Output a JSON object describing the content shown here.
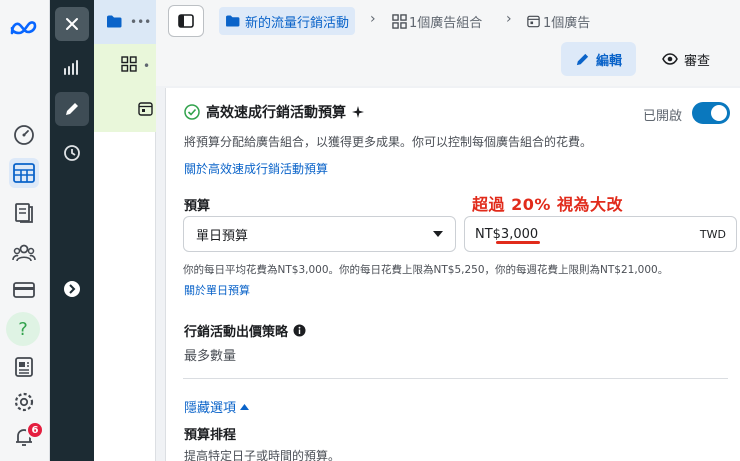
{
  "rail": {
    "icons": [
      "meta-logo-icon",
      "dashboard-gauge-icon",
      "ads-manager-table-icon",
      "catalog-book-icon",
      "audience-people-icon",
      "billing-card-icon",
      "help-icon",
      "news-icon",
      "settings-gear-icon",
      "notifications-bell-icon"
    ],
    "notifications_count": "6"
  },
  "tool_rail": {
    "icons": [
      "close-icon",
      "performance-chart-icon",
      "edit-pencil-icon",
      "history-clock-icon",
      "expand-arrow-icon"
    ]
  },
  "tree": {
    "rows": [
      {
        "icon": "folder-icon",
        "more": "•••"
      },
      {
        "icon": "ad-set-grid-icon",
        "more": "•"
      },
      {
        "icon": "ad-icon",
        "more": ""
      }
    ]
  },
  "header": {
    "breadcrumbs": [
      {
        "label": "新的流量行銷活動",
        "icon": "folder-icon"
      },
      {
        "label": "1個廣告組合",
        "icon": "ad-set-grid-icon"
      },
      {
        "label": "1個廣告",
        "icon": "ad-icon"
      }
    ],
    "edit_label": "編輯",
    "review_label": "審查"
  },
  "budget": {
    "title": "高效速成行銷活動預算",
    "toggle_label": "已開啟",
    "toggle_on": true,
    "description": "將預算分配給廣告組合，以獲得更多成果。你可以控制每個廣告組合的花費。",
    "about_link": "關於高效速成行銷活動預算",
    "budget_label": "預算",
    "budget_type": "單日預算",
    "amount": "NT$3,000",
    "currency": "TWD",
    "annotation": "超過 20% 視為大改",
    "spend_note": "你的每日平均花費為NT$3,000。你的每日花費上限為NT$5,250，你的每週花費上限則為NT$21,000。",
    "daily_link": "關於單日預算",
    "bid_strategy_label": "行銷活動出價策略",
    "bid_strategy_value": "最多數量",
    "hide_options": "隱藏選項",
    "schedule_label": "預算排程",
    "schedule_desc": "提高特定日子或時間的預算。"
  },
  "colors": {
    "accent": "#0a63c9",
    "annotation": "#e12b1b",
    "badge": "#e41e3f",
    "dark_rail": "#1c2b33"
  }
}
